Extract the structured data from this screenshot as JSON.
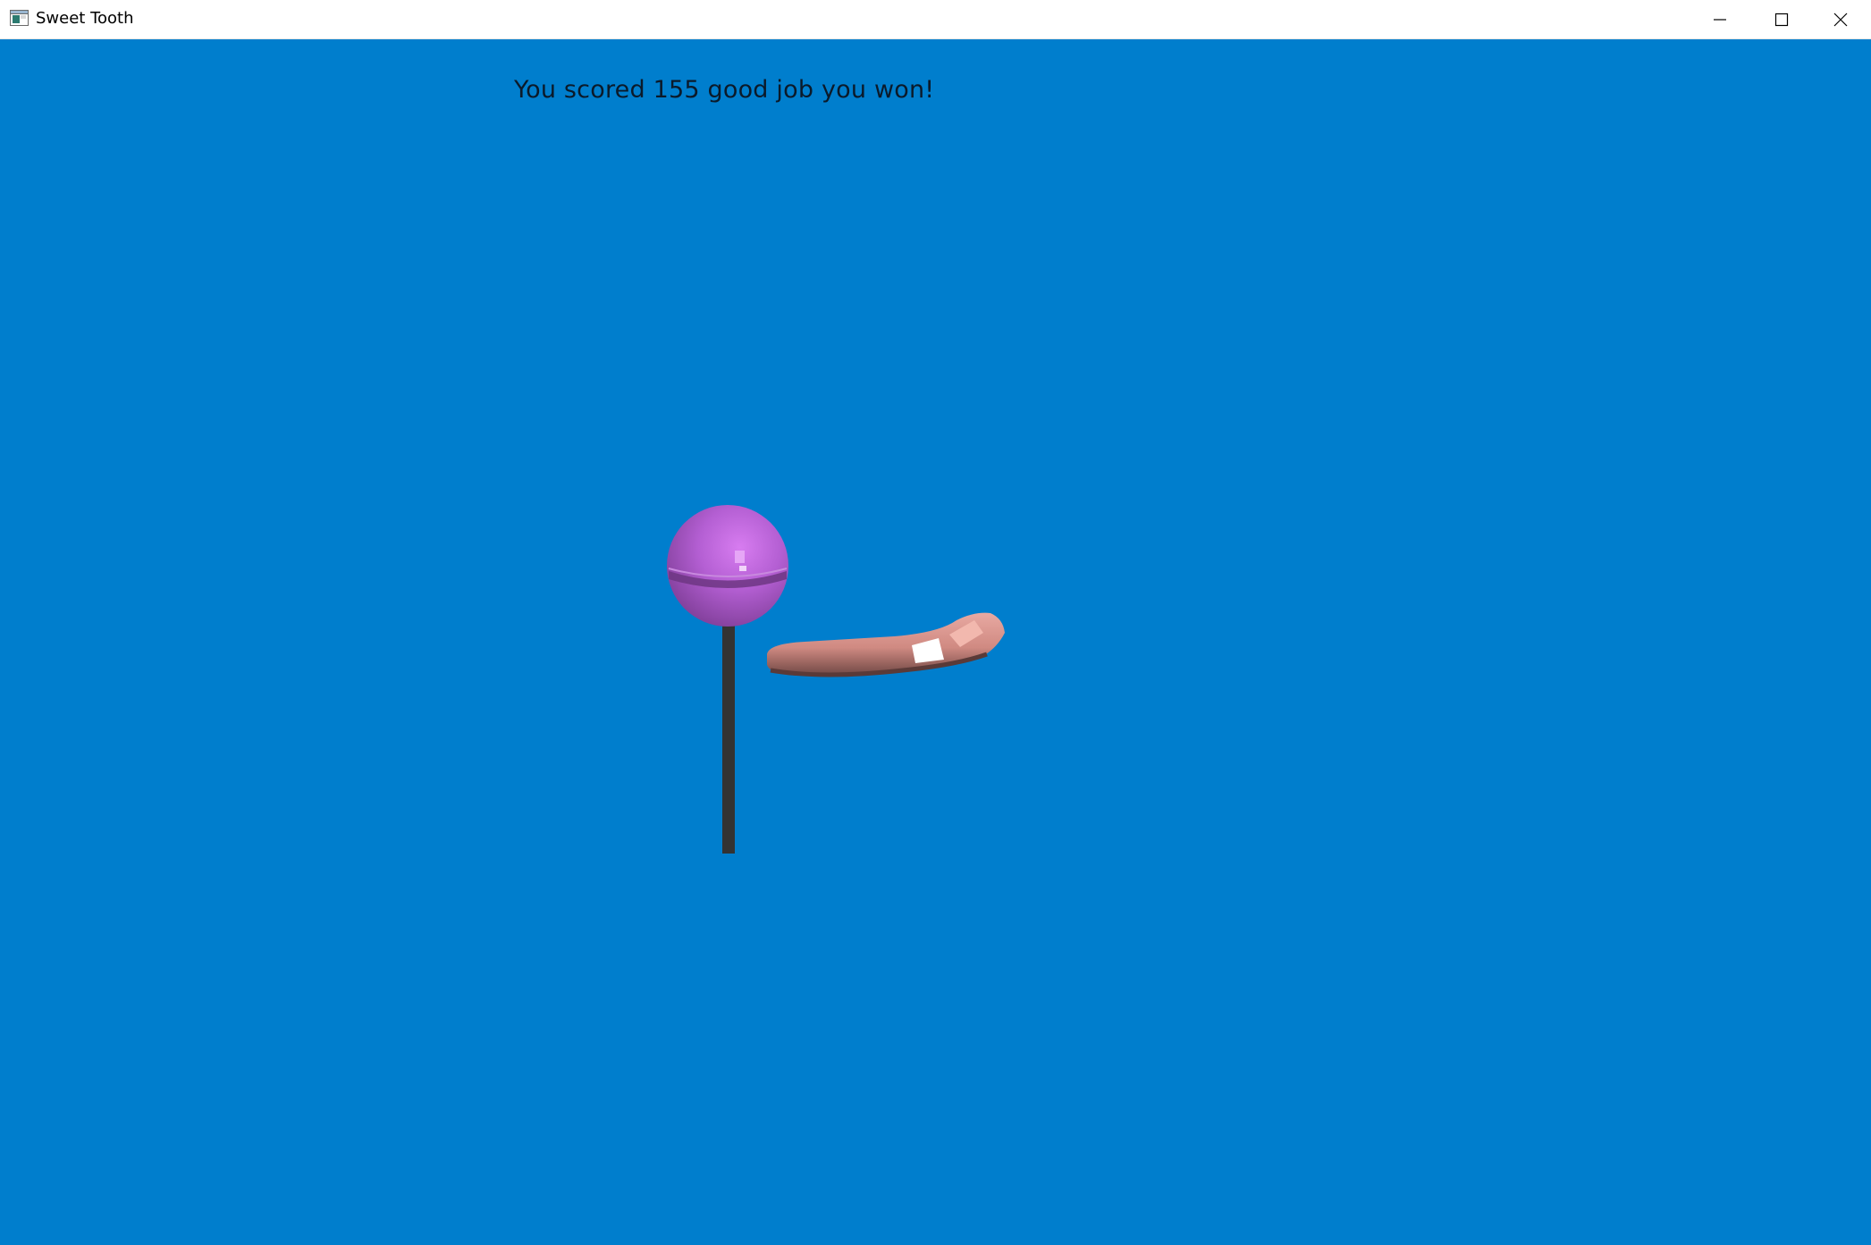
{
  "window": {
    "title": "Sweet Tooth",
    "icons": {
      "app": "app-window-icon",
      "minimize": "minimize-icon",
      "maximize": "maximize-icon",
      "close": "close-icon"
    }
  },
  "game": {
    "score_message": "You scored 155 good job you won!",
    "score": 155,
    "background_color": "#007ecd",
    "objects": {
      "lollipop": {
        "candy_color": "#b45fd3",
        "stick_color": "#333333"
      },
      "tongue": {
        "color": "#d88f88"
      }
    }
  }
}
